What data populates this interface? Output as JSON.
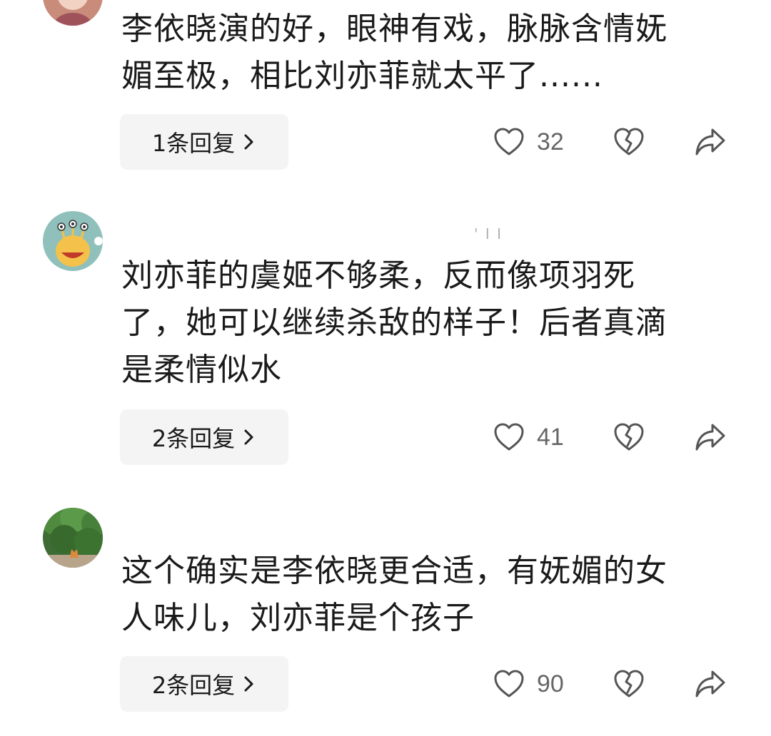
{
  "comments": [
    {
      "text": "李依晓演的好，眼神有戏，脉脉含情妩\n媚至极，相比刘亦菲就太平了......",
      "reply_label": "1条回复",
      "likes": "32",
      "username": ""
    },
    {
      "text": "刘亦菲的虞姬不够柔，反而像项羽死\n了，她可以继续杀敌的样子！后者真滴\n是柔情似水",
      "reply_label": "2条回复",
      "likes": "41",
      "username": "' I I"
    },
    {
      "text": "这个确实是李依晓更合适，有妩媚的女\n人味儿，刘亦菲是个孩子",
      "reply_label": "2条回复",
      "likes": "90",
      "username": ""
    }
  ],
  "icons": {
    "like": "heart-icon",
    "dislike": "broken-heart-icon",
    "share": "share-arrow-icon",
    "reply_chevron": "chevron-right-icon"
  },
  "colors": {
    "reply_button_bg": "#f4f4f4",
    "icon_stroke": "#555555",
    "count_text": "#666666"
  }
}
